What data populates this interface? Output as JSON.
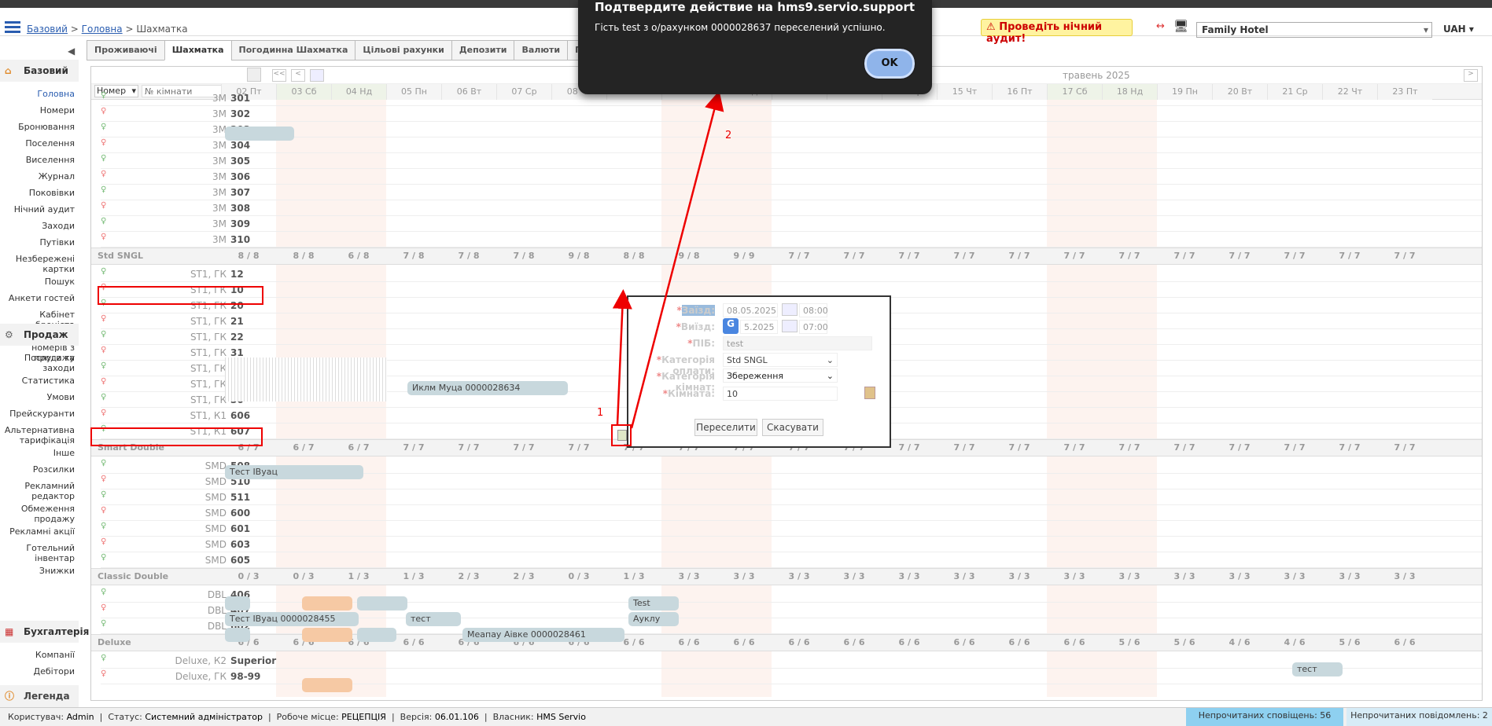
{
  "header": {
    "breadcrumb_home": "Базовий",
    "breadcrumb_main": "Головна",
    "breadcrumb_sep": " > ",
    "breadcrumb_current": "Шахматка",
    "audit": "Проведіть нічний аудит!",
    "hotel": "Family Hotel",
    "currency": "UAH"
  },
  "sidebar": {
    "base_title": "Базовий",
    "base_items": [
      "Головна",
      "Номери",
      "Бронювання",
      "Поселення",
      "Виселення",
      "Журнал",
      "Поковівки",
      "Нічний аудит",
      "Заходи",
      "Путівки",
      "Незбережені картки",
      "Пошук",
      "Анкети гостей",
      "Кабінет броніста",
      "Виведення номерів з продажу"
    ],
    "sales_title": "Продаж",
    "sales_items": [
      "Послуги та заходи",
      "Статистика",
      "Умови",
      "Прейскуранти",
      "Альтернативна тарифікація",
      "Інше",
      "Розсилки",
      "Рекламний редактор",
      "Обмеження продажу",
      "Рекламні акції",
      "Готельний інвентар",
      "Знижки"
    ],
    "acc_title": "Бухгалтерія",
    "acc_items": [
      "Компанії",
      "Дебітори"
    ],
    "legend": "Легенда"
  },
  "tabs": [
    "Проживаючі",
    "Шахматка",
    "Погодинна Шахматка",
    "Цільові рахунки",
    "Депозити",
    "Валюти",
    "План"
  ],
  "grid": {
    "month": "травень 2025",
    "filter_select": "Номер",
    "filter_placeholder": "№ кімнати",
    "days": [
      "02 Пт",
      "03 Сб",
      "04 Нд",
      "05 Пн",
      "06 Вт",
      "07 Ср",
      "08 Чт",
      "09 Пт",
      "10 Сб",
      "11 Нд",
      "12 Пн",
      "13 Вт",
      "14 Ср",
      "15 Чт",
      "16 Пт",
      "17 Сб",
      "18 Нд",
      "19 Пн",
      "20 Вт",
      "21 Ср",
      "22 Чт",
      "23 Пт"
    ],
    "groups": [
      {
        "name": "",
        "rooms": [
          {
            "prefix": "3М",
            "num": "301"
          },
          {
            "prefix": "3М",
            "num": "302"
          },
          {
            "prefix": "3М",
            "num": "303"
          },
          {
            "prefix": "3М",
            "num": "304"
          },
          {
            "prefix": "3М",
            "num": "305"
          },
          {
            "prefix": "3М",
            "num": "306"
          },
          {
            "prefix": "3М",
            "num": "307"
          },
          {
            "prefix": "3М",
            "num": "308"
          },
          {
            "prefix": "3М",
            "num": "309"
          },
          {
            "prefix": "3М",
            "num": "310"
          }
        ],
        "avail": []
      },
      {
        "name": "Std SNGL",
        "avail": [
          "8 / 8",
          "8 / 8",
          "6 / 8",
          "7 / 8",
          "7 / 8",
          "7 / 8",
          "9 / 8",
          "8 / 8",
          "9 / 8",
          "9 / 9",
          "7 / 7",
          "7 / 7",
          "7 / 7",
          "7 / 7",
          "7 / 7",
          "7 / 7",
          "7 / 7",
          "7 / 7",
          "7 / 7",
          "7 / 7",
          "7 / 7",
          "7 / 7"
        ],
        "rooms": [
          {
            "prefix": "ST1, ГК",
            "num": "12"
          },
          {
            "prefix": "ST1, ГК",
            "num": "10"
          },
          {
            "prefix": "ST1, ГК",
            "num": "20"
          },
          {
            "prefix": "ST1, ГК",
            "num": "21"
          },
          {
            "prefix": "ST1, ГК",
            "num": "22"
          },
          {
            "prefix": "ST1, ГК",
            "num": "31"
          },
          {
            "prefix": "ST1, ГК",
            "num": "32"
          },
          {
            "prefix": "ST1, ГК",
            "num": "11"
          },
          {
            "prefix": "ST1, ГК",
            "num": "30"
          },
          {
            "prefix": "ST1, К1",
            "num": "606"
          },
          {
            "prefix": "ST1, К1",
            "num": "607"
          }
        ]
      },
      {
        "name": "Smart Double",
        "avail": [
          "6 / 7",
          "6 / 7",
          "6 / 7",
          "7 / 7",
          "7 / 7",
          "7 / 7",
          "7 / 7",
          "7 / 7",
          "7 / 7",
          "7 / 7",
          "7 / 7",
          "7 / 7",
          "7 / 7",
          "7 / 7",
          "7 / 7",
          "7 / 7",
          "7 / 7",
          "7 / 7",
          "7 / 7",
          "7 / 7",
          "7 / 7",
          "7 / 7"
        ],
        "rooms": [
          {
            "prefix": "SMD",
            "num": "508"
          },
          {
            "prefix": "SMD",
            "num": "510"
          },
          {
            "prefix": "SMD",
            "num": "511"
          },
          {
            "prefix": "SMD",
            "num": "600"
          },
          {
            "prefix": "SMD",
            "num": "601"
          },
          {
            "prefix": "SMD",
            "num": "603"
          },
          {
            "prefix": "SMD",
            "num": "605"
          }
        ]
      },
      {
        "name": "Classic Double",
        "avail": [
          "0 / 3",
          "0 / 3",
          "1 / 3",
          "1 / 3",
          "2 / 3",
          "2 / 3",
          "0 / 3",
          "1 / 3",
          "3 / 3",
          "3 / 3",
          "3 / 3",
          "3 / 3",
          "3 / 3",
          "3 / 3",
          "3 / 3",
          "3 / 3",
          "3 / 3",
          "3 / 3",
          "3 / 3",
          "3 / 3",
          "3 / 3",
          "3 / 3"
        ],
        "rooms": [
          {
            "prefix": "DBL",
            "num": "406"
          },
          {
            "prefix": "DBL",
            "num": "407"
          },
          {
            "prefix": "DBL",
            "num": "602"
          }
        ]
      },
      {
        "name": "Deluxe",
        "avail": [
          "6 / 6",
          "6 / 6",
          "6 / 6",
          "6 / 6",
          "6 / 6",
          "6 / 6",
          "6 / 6",
          "6 / 6",
          "6 / 6",
          "6 / 6",
          "6 / 6",
          "6 / 6",
          "6 / 6",
          "6 / 6",
          "6 / 6",
          "6 / 6",
          "5 / 6",
          "5 / 6",
          "4 / 6",
          "4 / 6",
          "5 / 6",
          "6 / 6"
        ],
        "rooms": [
          {
            "prefix": "Deluxe, К2",
            "num": "Superior"
          },
          {
            "prefix": "Deluxe, ГК",
            "num": "98-99"
          }
        ]
      }
    ],
    "bars": {
      "smd508": "Тест ІВуац",
      "st11": "Иклм Муца  0000028634",
      "dbl406": "Test",
      "dbl407a": "Тест ІВуац 0000028455",
      "dbl407b": "тест",
      "dbl407c": "Ауклу",
      "dbl602": "Меапау Аівке  0000028461",
      "deluxe": "тест"
    }
  },
  "popup": {
    "checkin_label": "Заїзд:",
    "checkin_date": "08.05.2025",
    "checkin_time": "08:00",
    "checkout_label": "Виїзд:",
    "checkout_date": "5.2025",
    "checkout_time": "07:00",
    "name_label": "ПІБ:",
    "name_value": "test",
    "paycat_label": "Категорія оплати:",
    "paycat_value": "Std SNGL",
    "roomcat_label": "Категорія кімнат:",
    "roomcat_value": "Збереження",
    "room_label": "Кімната:",
    "room_value": "10",
    "move_btn": "Переселити",
    "cancel_btn": "Скасувати"
  },
  "dialog": {
    "title": "Подтвердите действие на hms9.servio.support",
    "message": "Гість test з о/рахунком 0000028637 переселений успішно.",
    "ok": "OK"
  },
  "annotations": {
    "one": "1",
    "two": "2"
  },
  "status": {
    "user_label": "Користувач:",
    "user": "Admin",
    "status_label": "Статус:",
    "status": "Системний адміністратор",
    "place_label": "Робоче місце:",
    "place": "РЕЦЕПЦІЯ",
    "version_label": "Версія:",
    "version": "06.01.106",
    "owner_label": "Власник:",
    "owner": "HMS Servio",
    "unread_alerts": "Непрочитаних сповіщень: 56",
    "unread_messages": "Непрочитаних повідомлень: 2"
  }
}
